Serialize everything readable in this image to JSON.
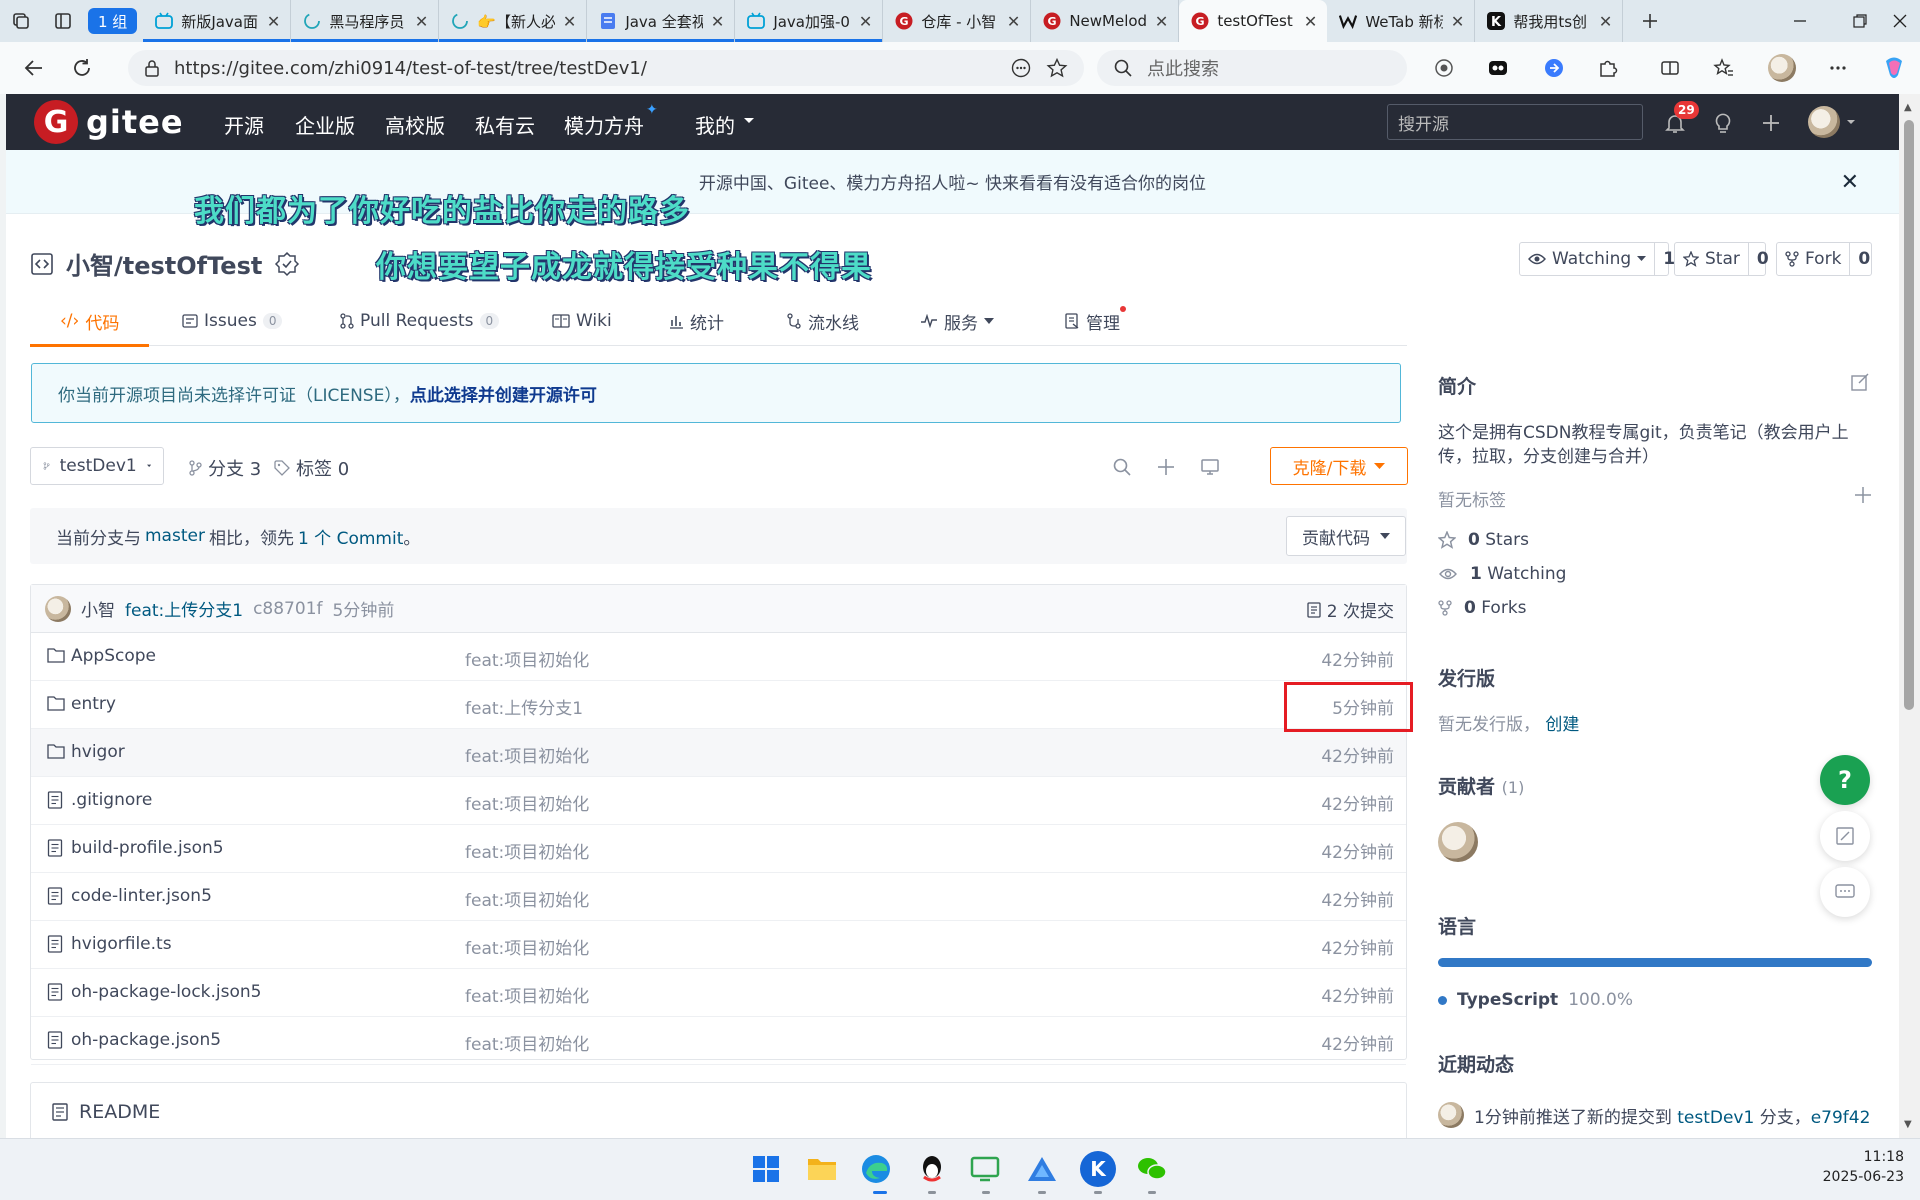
{
  "browser": {
    "group_label": "1 组",
    "tabs": [
      {
        "title": "新版Java面",
        "favicon": "bilibili-icon",
        "color": "#00a1d6"
      },
      {
        "title": "黑马程序员",
        "favicon": "loading-icon",
        "color": "#21a5b8"
      },
      {
        "title": "👉【新人必",
        "favicon": "loading-icon",
        "color": "#21a5b8"
      },
      {
        "title": "Java 全套视",
        "favicon": "doc-icon",
        "color": "#4a7cf0"
      },
      {
        "title": "Java加强-0",
        "favicon": "bilibili-icon",
        "color": "#00a1d6"
      },
      {
        "title": "仓库 - 小智",
        "favicon": "gitee-icon",
        "color": "#c71d23"
      },
      {
        "title": "NewMelod",
        "favicon": "gitee-icon",
        "color": "#c71d23"
      },
      {
        "title": "testOfTest",
        "favicon": "gitee-icon",
        "color": "#c71d23"
      },
      {
        "title": "WeTab 新标",
        "favicon": "wetab-icon",
        "color": "#111111"
      },
      {
        "title": "帮我用ts创",
        "favicon": "kimi-icon",
        "color": "#111111"
      }
    ],
    "url": "https://gitee.com/zhi0914/test-of-test/tree/testDev1/",
    "search_placeholder": "点此搜索"
  },
  "gitee": {
    "logo_text": "gitee",
    "nav": [
      "开源",
      "企业版",
      "高校版",
      "私有云",
      "模力方舟",
      "我的"
    ],
    "search_placeholder": "搜开源",
    "notification_count": "29"
  },
  "announcement": "开源中国、Gitee、模力方舟招人啦~ 快来看看有没有适合你的岗位",
  "overlays": [
    "我们都为了你好吃的盐比你走的路多",
    "你想要望子成龙就得接受种果不得果"
  ],
  "repo": {
    "title": "小智/testOfTest",
    "watch_label": "Watching",
    "watch_count": "1",
    "star_label": "Star",
    "star_count": "0",
    "fork_label": "Fork",
    "fork_count": "0"
  },
  "tabs": [
    {
      "label": "代码"
    },
    {
      "label": "Issues",
      "count": "0"
    },
    {
      "label": "Pull Requests",
      "count": "0"
    },
    {
      "label": "Wiki"
    },
    {
      "label": "统计"
    },
    {
      "label": "流水线"
    },
    {
      "label": "服务"
    },
    {
      "label": "管理"
    }
  ],
  "license": {
    "text": "你当前开源项目尚未选择许可证（LICENSE），",
    "link": "点此选择并创建开源许可"
  },
  "branch": {
    "current": "testDev1",
    "branches": "分支 3",
    "tags": "标签 0",
    "clone_label": "克隆/下载"
  },
  "ahead": {
    "prefix": "当前分支与",
    "base": "master",
    "middle": "相比，领先",
    "count": "1 个 Commit",
    "suffix": "。",
    "contribute_label": "贡献代码"
  },
  "latest_commit": {
    "author": "小智",
    "message": "feat:上传分支1",
    "hash": "c88701f",
    "time": "5分钟前",
    "commit_count": "2 次提交"
  },
  "files": [
    {
      "name": "AppScope",
      "type": "folder",
      "message": "feat:项目初始化",
      "time": "42分钟前"
    },
    {
      "name": "entry",
      "type": "folder",
      "message": "feat:上传分支1",
      "time": "5分钟前"
    },
    {
      "name": "hvigor",
      "type": "folder",
      "message": "feat:项目初始化",
      "time": "42分钟前"
    },
    {
      "name": ".gitignore",
      "type": "file",
      "message": "feat:项目初始化",
      "time": "42分钟前"
    },
    {
      "name": "build-profile.json5",
      "type": "file",
      "message": "feat:项目初始化",
      "time": "42分钟前"
    },
    {
      "name": "code-linter.json5",
      "type": "file",
      "message": "feat:项目初始化",
      "time": "42分钟前"
    },
    {
      "name": "hvigorfile.ts",
      "type": "file",
      "message": "feat:项目初始化",
      "time": "42分钟前"
    },
    {
      "name": "oh-package-lock.json5",
      "type": "file",
      "message": "feat:项目初始化",
      "time": "42分钟前"
    },
    {
      "name": "oh-package.json5",
      "type": "file",
      "message": "feat:项目初始化",
      "time": "42分钟前"
    }
  ],
  "readme_label": "README",
  "sidebar": {
    "intro_title": "简介",
    "intro_text_1": "这个是拥有CSDN教程专属git，负责笔记（教会用户上",
    "intro_text_2": "传，拉取，分支创建与合并）",
    "no_tags": "暂无标签",
    "stars": {
      "count": "0",
      "label": "Stars"
    },
    "watching": {
      "count": "1",
      "label": "Watching"
    },
    "forks": {
      "count": "0",
      "label": "Forks"
    },
    "release_title": "发行版",
    "release_text": "暂无发行版，",
    "release_link": "创建",
    "contributors_title": "贡献者",
    "contributors_count": "(1)",
    "language_title": "语言",
    "language": {
      "name": "TypeScript",
      "percent": "100.0%",
      "share": 1.0,
      "color": "#3178c6"
    },
    "activity_title": "近期动态",
    "activity_text": "1分钟前推送了新的提交到",
    "activity_branch": "testDev1",
    "activity_mid": " 分支，",
    "activity_hash": "e79f42"
  },
  "clock": {
    "time": "11:18",
    "date": "2025-06-23"
  }
}
